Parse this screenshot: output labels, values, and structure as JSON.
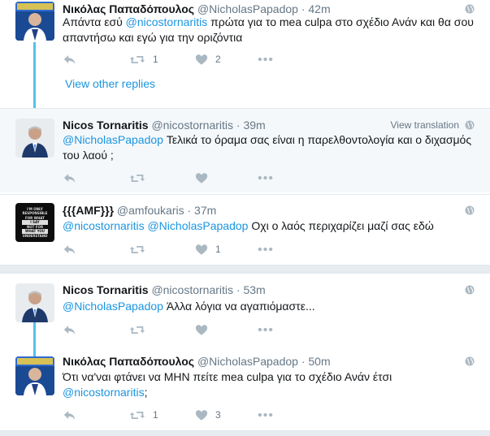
{
  "tweets": [
    {
      "name": "Νικόλας Παπαδόπουλος",
      "handle": "@NicholasPapadop",
      "dot": "·",
      "time": "42m",
      "text_parts": [
        "Απάντα εσύ ",
        "@nicostornaritis",
        " πρώτα για το mea culpa στο σχέδιο Ανάν και θα σου απαντήσω και εγώ για την οριζόντια"
      ],
      "retweets": "1",
      "likes": "2"
    },
    {
      "name": "Nicos Tornaritis",
      "handle": "@nicostornaritis",
      "dot": "·",
      "time": "39m",
      "view_translation": "View translation",
      "text_parts": [
        "@NicholasPapadop",
        " Τελικά το όραμα σας είναι η παρελθοντολογία και ο διχασμός του λαού  ;"
      ],
      "retweets": "",
      "likes": ""
    },
    {
      "name": "{{{AMF}}}",
      "handle": "@amfoukaris",
      "dot": "·",
      "time": "37m",
      "text_parts": [
        "@nicostornaritis",
        " ",
        "@NicholasPapadop",
        " Οχι ο λαός περιχαρίζει μαζί σας εδώ"
      ],
      "retweets": "",
      "likes": "1",
      "avatar_lines": [
        "I'M ONLY",
        "RESPONSIBLE",
        "FOR WHAT",
        "I SAY",
        "NOT FOR",
        "WHAT YOU",
        "UNDERSTAND"
      ]
    },
    {
      "name": "Nicos Tornaritis",
      "handle": "@nicostornaritis",
      "dot": "·",
      "time": "53m",
      "text_parts": [
        "@NicholasPapadop",
        " Άλλα λόγια να αγαπιόμαστε..."
      ],
      "retweets": "",
      "likes": ""
    },
    {
      "name": "Νικόλας Παπαδόπουλος",
      "handle": "@NicholasPapadop",
      "dot": "·",
      "time": "50m",
      "text_parts": [
        "Ότι να'ναι φτάνει να ΜΗΝ πείτε mea culpa για το σχέδιο Ανάν έτσι ",
        "@nicostornaritis",
        ";"
      ],
      "retweets": "1",
      "likes": "3"
    }
  ],
  "view_other_replies": "View other replies",
  "colors": {
    "link": "#1b95e0",
    "thread_line": "#55c1e8",
    "muted": "#657786"
  },
  "icons": [
    "reply-icon",
    "retweet-icon",
    "like-icon",
    "more-icon",
    "globe-icon"
  ]
}
